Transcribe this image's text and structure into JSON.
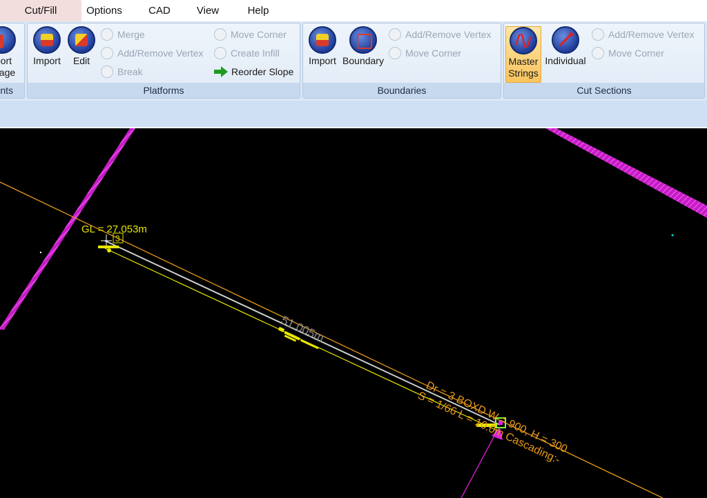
{
  "menu": {
    "items": [
      "Cut/Fill",
      "Options",
      "CAD",
      "View",
      "Help"
    ],
    "active_index": 0
  },
  "ribbon": {
    "partial_group": {
      "button_label_line1": "port",
      "button_label_line2": "nage",
      "group_label": "ints"
    },
    "platforms": {
      "label": "Platforms",
      "import_label": "Import",
      "edit_label": "Edit",
      "merge_label": "Merge",
      "add_remove_vertex_label": "Add/Remove Vertex",
      "break_label": "Break",
      "move_corner_label": "Move Corner",
      "create_infill_label": "Create Infill",
      "reorder_slope_label": "Reorder Slope"
    },
    "boundaries": {
      "label": "Boundaries",
      "import_label": "Import",
      "boundary_label": "Boundary",
      "add_remove_vertex_label": "Add/Remove Vertex",
      "move_corner_label": "Move Corner"
    },
    "cut_sections": {
      "label": "Cut Sections",
      "master_line1": "Master",
      "master_line2": "Strings",
      "individual_label": "Individual",
      "add_remove_vertex_label": "Add/Remove Vertex",
      "move_corner_label": "Move Corner"
    }
  },
  "canvas": {
    "gl_label": "GL = 27.053m",
    "node_label": "3",
    "length_label": "51.005m",
    "annotation_line1": "Dr = 3  BOXD  W = 900, H = 300",
    "annotation_line2": "S = 1/66  L = 10.0m  Cascading:-",
    "colors": {
      "boundary": "#e020e0",
      "pipe_orange": "#e89a1a",
      "pipe_yellow": "#e8e800",
      "pipe_white": "#cfcfcf",
      "label_yellow": "#e6e600",
      "dim_grey": "#8a8a8a"
    }
  }
}
